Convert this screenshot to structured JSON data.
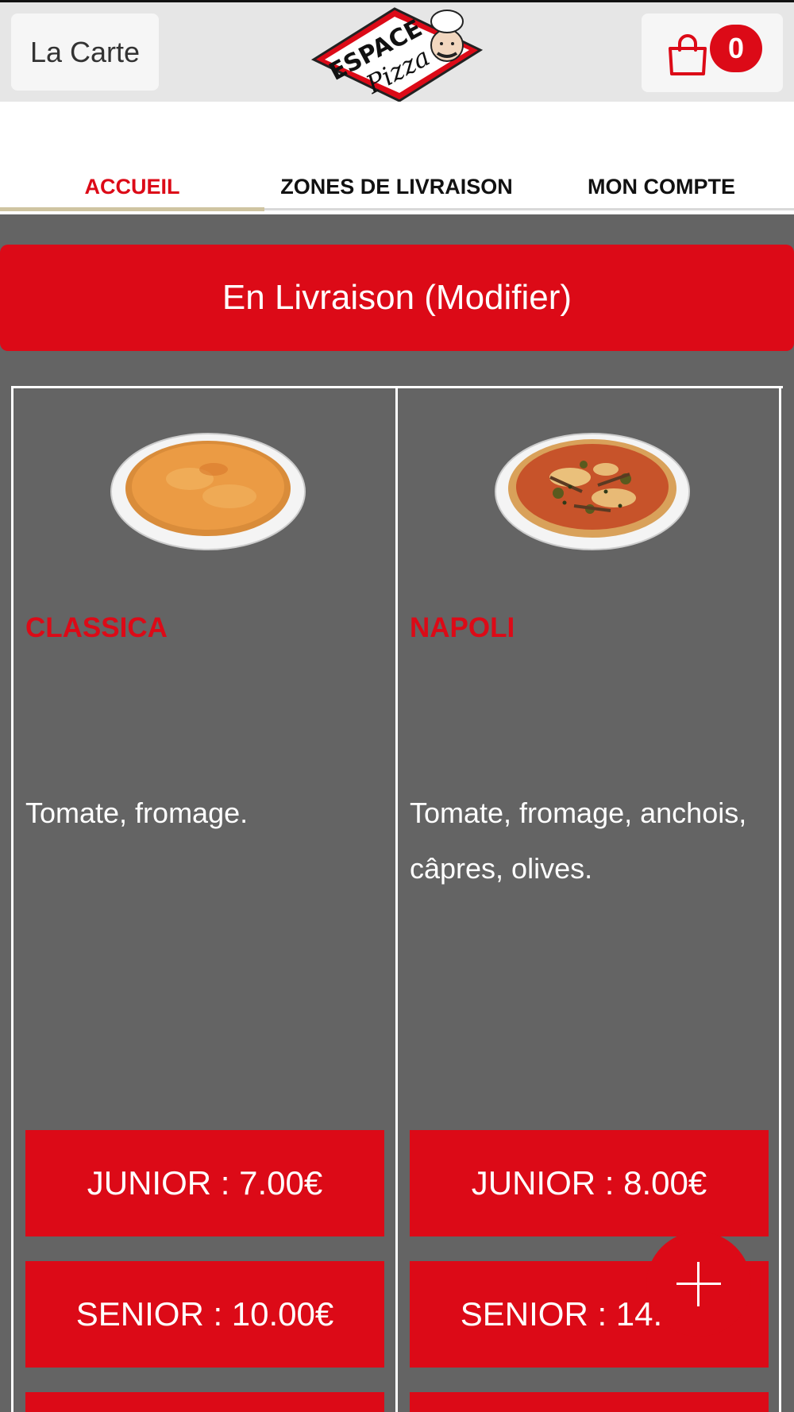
{
  "header": {
    "carte_label": "La Carte",
    "logo": {
      "line1": "ESPACE",
      "line2": "Pizza"
    },
    "cart": {
      "icon": "shopping-bag-icon",
      "count": "0"
    }
  },
  "nav": {
    "tabs": [
      {
        "label": "ACCUEIL",
        "active": true
      },
      {
        "label": "ZONES DE LIVRAISON",
        "active": false
      },
      {
        "label": "MON COMPTE",
        "active": false
      }
    ]
  },
  "delivery": {
    "label": "En Livraison (Modifier)"
  },
  "products": [
    {
      "name": "CLASSICA",
      "description": "Tomate, fromage.",
      "prices": [
        "JUNIOR : 7.00€",
        "SENIOR : 10.00€"
      ]
    },
    {
      "name": "NAPOLI",
      "description": "Tomate, fromage, anchois, câpres, olives.",
      "prices": [
        "JUNIOR : 8.00€",
        "SENIOR : 14.00€"
      ]
    }
  ],
  "fab": {
    "icon": "plus-icon"
  },
  "colors": {
    "brand_red": "#dc0a17",
    "background": "#646464",
    "header_bg": "#e6e6e6"
  }
}
